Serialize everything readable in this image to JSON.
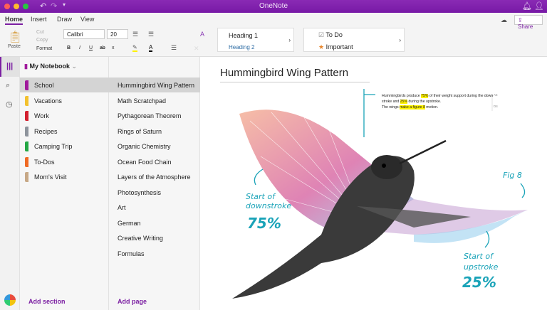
{
  "app": {
    "title": "OneNote"
  },
  "ribbon": {
    "tabs": [
      "Home",
      "Insert",
      "Draw",
      "View"
    ],
    "paste": "Paste",
    "cut": "Cut",
    "copy": "Copy",
    "format": "Format",
    "font": "Calibri",
    "size": "20",
    "bold": "B",
    "italic": "I",
    "underline": "U",
    "strike": "ab",
    "subscript": "x",
    "styles": {
      "h1": "Heading 1",
      "h2": "Heading 2"
    },
    "tags": {
      "todo": "To Do",
      "important": "Important"
    },
    "share": "Share"
  },
  "notebook": {
    "name": "My Notebook",
    "sections": [
      {
        "label": "School",
        "color": "#a0199b"
      },
      {
        "label": "Vacations",
        "color": "#f2c12e"
      },
      {
        "label": "Work",
        "color": "#d3202f"
      },
      {
        "label": "Recipes",
        "color": "#8e949c"
      },
      {
        "label": "Camping Trip",
        "color": "#23a744"
      },
      {
        "label": "To-Dos",
        "color": "#ef6a24"
      },
      {
        "label": "Mom's Visit",
        "color": "#c7a886"
      }
    ],
    "add_section": "Add section"
  },
  "pages": {
    "items": [
      "Hummingbird Wing Pattern",
      "Math Scratchpad",
      "Pythagorean Theorem",
      "Rings of Saturn",
      "Organic Chemistry",
      "Ocean Food Chain",
      "Layers of the Atmosphere",
      "Photosynthesis",
      "Art",
      "German",
      "Creative Writing",
      "Formulas"
    ],
    "add_page": "Add page"
  },
  "page": {
    "title": "Hummingbird Wing Pattern",
    "note": {
      "p1": "Hummingbirds produce ",
      "h1": "75%",
      "p2": " of their weight support during the down stroke and ",
      "h2": "25%",
      "p3": " during the upstroke.",
      "p4": "The wings ",
      "h3": "make a figure 8",
      "p5": " motion."
    },
    "margin_labels": [
      "A5",
      "D4"
    ],
    "annotations": {
      "downstroke": "Start of downstroke",
      "pct75": "75%",
      "fig8": "Fig 8",
      "upstroke": "Start of upstroke",
      "pct25": "25%"
    }
  },
  "colors": {
    "accent": "#7b1fa2",
    "ink": "#1aa3b8"
  }
}
